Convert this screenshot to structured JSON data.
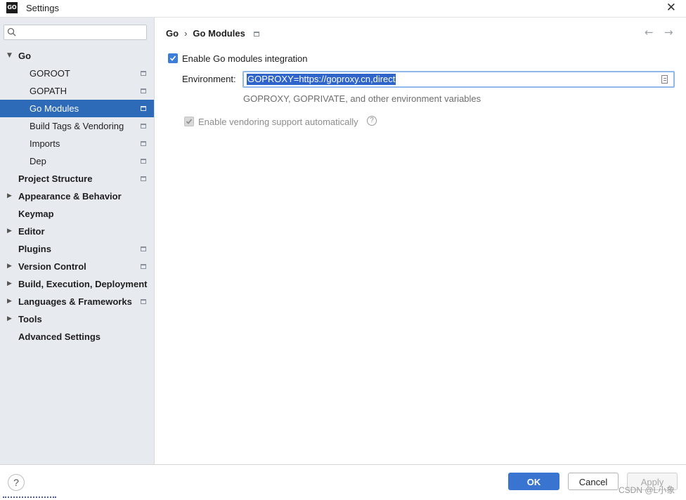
{
  "window": {
    "title": "Settings",
    "logo_text": "GO",
    "close_glyph": "✕"
  },
  "sidebar": {
    "search": {
      "value": "",
      "placeholder": ""
    },
    "items": [
      {
        "label": "Go",
        "level": 0,
        "expandable": true,
        "expanded": true,
        "bold": true,
        "project_icon": false
      },
      {
        "label": "GOROOT",
        "level": 1,
        "bold": false,
        "project_icon": true
      },
      {
        "label": "GOPATH",
        "level": 1,
        "bold": false,
        "project_icon": true
      },
      {
        "label": "Go Modules",
        "level": 1,
        "bold": false,
        "project_icon": true,
        "selected": true
      },
      {
        "label": "Build Tags & Vendoring",
        "level": 1,
        "bold": false,
        "project_icon": true
      },
      {
        "label": "Imports",
        "level": 1,
        "bold": false,
        "project_icon": true
      },
      {
        "label": "Dep",
        "level": 1,
        "bold": false,
        "project_icon": true
      },
      {
        "label": "Project Structure",
        "level": 0,
        "bold": true,
        "project_icon": true
      },
      {
        "label": "Appearance & Behavior",
        "level": 0,
        "expandable": true,
        "bold": true,
        "project_icon": false
      },
      {
        "label": "Keymap",
        "level": 0,
        "bold": true,
        "project_icon": false
      },
      {
        "label": "Editor",
        "level": 0,
        "expandable": true,
        "bold": true,
        "project_icon": false
      },
      {
        "label": "Plugins",
        "level": 0,
        "bold": true,
        "project_icon": true
      },
      {
        "label": "Version Control",
        "level": 0,
        "expandable": true,
        "bold": true,
        "project_icon": true
      },
      {
        "label": "Build, Execution, Deployment",
        "level": 0,
        "expandable": true,
        "bold": true,
        "project_icon": false
      },
      {
        "label": "Languages & Frameworks",
        "level": 0,
        "expandable": true,
        "bold": true,
        "project_icon": true
      },
      {
        "label": "Tools",
        "level": 0,
        "expandable": true,
        "bold": true,
        "project_icon": false
      },
      {
        "label": "Advanced Settings",
        "level": 0,
        "bold": true,
        "project_icon": false
      }
    ]
  },
  "breadcrumb": {
    "parent": "Go",
    "separator": "›",
    "current": "Go Modules",
    "back_glyph": "←",
    "forward_glyph": "→"
  },
  "settings": {
    "enable_modules": {
      "label": "Enable Go modules integration",
      "checked": true
    },
    "environment": {
      "label": "Environment:",
      "value": "GOPROXY=https://goproxy.cn,direct",
      "hint": "GOPROXY, GOPRIVATE, and other environment variables"
    },
    "vendoring": {
      "label": "Enable vendoring support automatically",
      "checked": true,
      "disabled": true,
      "help_glyph": "?"
    }
  },
  "footer": {
    "help_glyph": "?",
    "ok_label": "OK",
    "cancel_label": "Cancel",
    "apply_label": "Apply",
    "watermark": "CSDN @L小象"
  },
  "colors": {
    "accent": "#3874d0",
    "selection": "#2d6ab8",
    "sidebar_bg": "#e7ebf0"
  }
}
